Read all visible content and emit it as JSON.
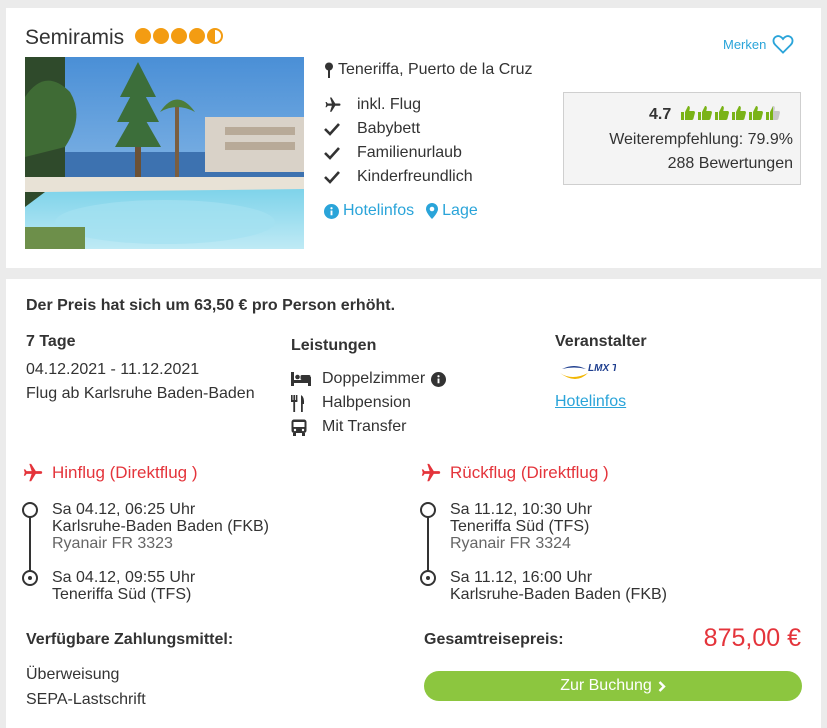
{
  "hotel": {
    "name": "Semiramis",
    "stars": 4.5,
    "merken_label": "Merken",
    "location": "Teneriffa, Puerto de la Cruz",
    "features": [
      "inkl. Flug",
      "Babybett",
      "Familienurlaub",
      "Kinderfreundlich"
    ],
    "hotelinfos_label": "Hotelinfos",
    "lage_label": "Lage",
    "rating": {
      "score": "4.7",
      "thumbs": 6,
      "thumbs_filled": 5.5,
      "recommendation": "Weiterempfehlung: 79.9%",
      "reviews": "288 Bewertungen"
    }
  },
  "offer": {
    "price_note": "Der Preis hat sich um 63,50 € pro Person erhöht.",
    "days": "7 Tage",
    "dates": "04.12.2021 - 11.12.2021",
    "departure": "Flug ab Karlsruhe Baden-Baden",
    "leistungen_title": "Leistungen",
    "leistungen": [
      "Doppelzimmer",
      "Halbpension",
      "Mit Transfer"
    ],
    "veranstalter_title": "Veranstalter",
    "veranstalter_logo_text": "LMX Touristik",
    "veranstalter_link": "Hotelinfos"
  },
  "flights": {
    "outbound": {
      "title": "Hinflug (Direktflug )",
      "dep_time": "Sa 04.12, 06:25 Uhr",
      "dep_airport": "Karlsruhe-Baden Baden (FKB)",
      "flight_no": "Ryanair FR 3323",
      "arr_time": "Sa 04.12, 09:55 Uhr",
      "arr_airport": "Teneriffa Süd (TFS)"
    },
    "return": {
      "title": "Rückflug (Direktflug )",
      "dep_time": "Sa 11.12, 10:30 Uhr",
      "dep_airport": "Teneriffa Süd (TFS)",
      "flight_no": "Ryanair FR 3324",
      "arr_time": "Sa 11.12, 16:00 Uhr",
      "arr_airport": "Karlsruhe-Baden Baden (FKB)"
    }
  },
  "payment": {
    "title": "Verfügbare Zahlungsmittel:",
    "methods": [
      "Überweisung",
      "SEPA-Lastschrift"
    ]
  },
  "total": {
    "label": "Gesamtreisepreis:",
    "price": "875,00 €",
    "book_label": "Zur Buchung"
  },
  "colors": {
    "accent_blue": "#2aa4d9",
    "price_red": "#e4343b",
    "button_green": "#8cc63f",
    "star_orange": "#f39c12",
    "thumb_green": "#7ab317"
  },
  "icons": [
    "heart-icon",
    "map-pin-icon",
    "plane-icon",
    "check-icon",
    "info-icon",
    "location-icon",
    "bed-icon",
    "cutlery-icon",
    "bus-icon",
    "chevron-right-icon"
  ]
}
